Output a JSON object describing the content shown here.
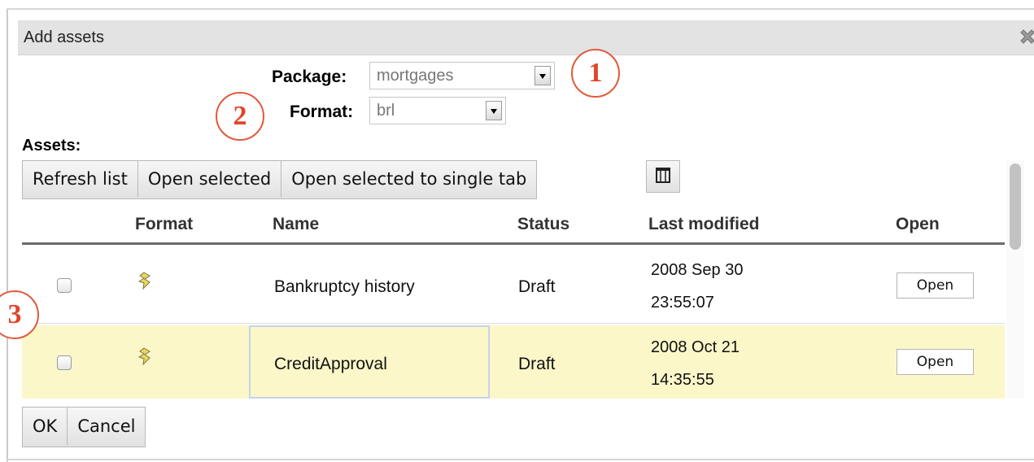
{
  "dialog": {
    "title": "Add assets"
  },
  "form": {
    "package_label": "Package:",
    "package_value": "mortgages",
    "format_label": "Format:",
    "format_value": "brl"
  },
  "annotations": [
    "1",
    "2",
    "3"
  ],
  "assets_label": "Assets:",
  "toolbar": {
    "refresh": "Refresh list",
    "open_selected": "Open selected",
    "open_single_tab": "Open selected to single tab",
    "columns_icon": "columns-icon"
  },
  "table": {
    "headers": [
      "Format",
      "Name",
      "Status",
      "Last modified",
      "Open"
    ],
    "rows": [
      {
        "format_icon": "rule-file-icon",
        "name": "Bankruptcy history",
        "status": "Draft",
        "date": "2008 Sep 30",
        "time": "23:55:07",
        "open": "Open"
      },
      {
        "format_icon": "rule-file-icon",
        "name": "CreditApproval",
        "status": "Draft",
        "date": "2008 Oct 21",
        "time": "14:35:55",
        "open": "Open"
      }
    ]
  },
  "footer": {
    "ok": "OK",
    "cancel": "Cancel"
  },
  "colors": {
    "badge": "#e05a3a",
    "selected_row": "#fbf7c9",
    "titlebar": "#e3e3e3"
  }
}
